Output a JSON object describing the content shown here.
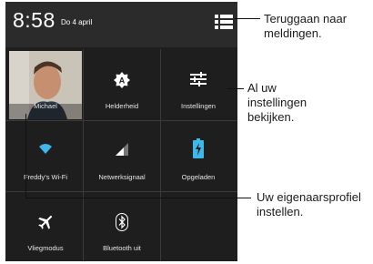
{
  "status": {
    "time": "8:58",
    "date": "Do 4 april"
  },
  "tiles": [
    {
      "label": "Michael",
      "icon": "profile-photo"
    },
    {
      "label": "Helderheid",
      "icon": "brightness-auto-icon"
    },
    {
      "label": "Instellingen",
      "icon": "settings-sliders-icon"
    },
    {
      "label": "Freddy's Wi-Fi",
      "icon": "wifi-icon"
    },
    {
      "label": "Netwerksignaal",
      "icon": "signal-icon"
    },
    {
      "label": "Opgeladen",
      "icon": "battery-charging-icon"
    },
    {
      "label": "Vliegmodus",
      "icon": "airplane-icon"
    },
    {
      "label": "Bluetooth uit",
      "icon": "bluetooth-icon"
    }
  ],
  "callouts": {
    "notifications": [
      "Teruggaan naar",
      "meldingen."
    ],
    "settings": [
      "Al uw",
      "instellingen",
      "bekijken."
    ],
    "profile": [
      "Uw eigenaarsprofiel",
      "instellen."
    ]
  },
  "colors": {
    "battery": "#3fb7e8",
    "wifi": "#3fb7e8",
    "panel": "#1e1e1e"
  }
}
